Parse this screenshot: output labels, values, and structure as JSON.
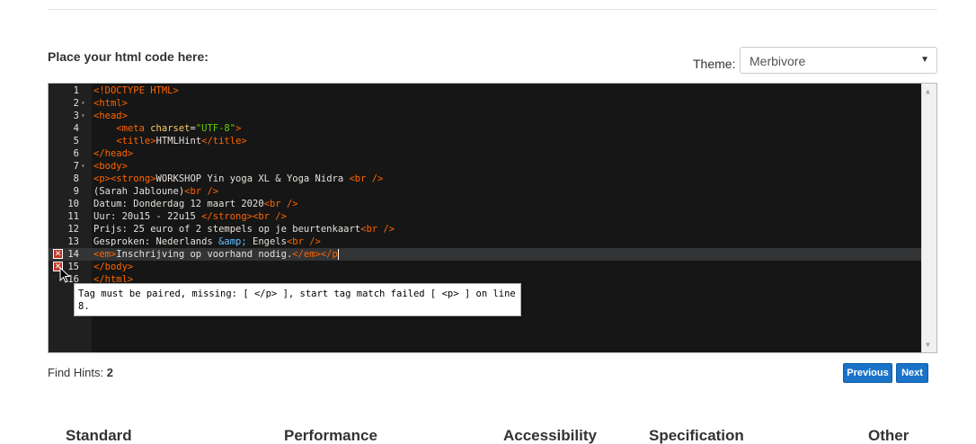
{
  "header": {
    "code_label": "Place your html code here:",
    "theme_label": "Theme:",
    "theme_value": "Merbivore"
  },
  "editor": {
    "lines": [
      {
        "n": "1",
        "fold": false,
        "error": false
      },
      {
        "n": "2",
        "fold": true,
        "error": false
      },
      {
        "n": "3",
        "fold": true,
        "error": false
      },
      {
        "n": "4",
        "fold": false,
        "error": false
      },
      {
        "n": "5",
        "fold": false,
        "error": false
      },
      {
        "n": "6",
        "fold": false,
        "error": false
      },
      {
        "n": "7",
        "fold": true,
        "error": false
      },
      {
        "n": "8",
        "fold": false,
        "error": false
      },
      {
        "n": "9",
        "fold": false,
        "error": false
      },
      {
        "n": "10",
        "fold": false,
        "error": false
      },
      {
        "n": "11",
        "fold": false,
        "error": false
      },
      {
        "n": "12",
        "fold": false,
        "error": false
      },
      {
        "n": "13",
        "fold": false,
        "error": false
      },
      {
        "n": "14",
        "fold": false,
        "error": true
      },
      {
        "n": "15",
        "fold": false,
        "error": true
      },
      {
        "n": "16",
        "fold": false,
        "error": false
      }
    ],
    "code": {
      "l1": "<!DOCTYPE HTML>",
      "l2": "<html>",
      "l3": "<head>",
      "l4_open": "<meta ",
      "l4_attr": "charset",
      "l4_eq": "=",
      "l4_str": "\"UTF-8\"",
      "l4_close": ">",
      "l5_open": "<title>",
      "l5_text": "HTMLHint",
      "l5_close": "</title>",
      "l6": "</head>",
      "l7": "<body>",
      "l8_tag": "<p><strong>",
      "l8_text": "WORKSHOP Yin yoga XL & Yoga Nidra ",
      "l8_br": "<br />",
      "l9_text": "(Sarah Jabloune)",
      "l9_br": "<br />",
      "l10_text": "Datum: Donderdag 12 maart 2020",
      "l10_br": "<br />",
      "l11_text": "Uur: 20u15 - 22u15 ",
      "l11_tag": "</strong><br />",
      "l12_text": "Prijs: 25 euro of 2 stempels op je beurtenkaart",
      "l12_br": "<br />",
      "l13_text": "Gesproken: Nederlands ",
      "l13_ent": "&amp;",
      "l13_text2": " Engels",
      "l13_br": "<br />",
      "l14_tag": "<em>",
      "l14_text": "Inschrijving op voorhand nodig.",
      "l14_tag2": "</em></p",
      "l15": "</body>",
      "l16": "</html>"
    },
    "tooltip": "Tag must be paired, missing: [ </p> ], start tag match failed [ <p> ] on line 8."
  },
  "footer": {
    "hints_label": "Find Hints: ",
    "hints_count": "2",
    "prev_label": "Previous",
    "next_label": "Next"
  },
  "categories": [
    "Standard",
    "Performance",
    "Accessibility",
    "Specification",
    "Other"
  ],
  "colors": {
    "editor_bg": "#161616",
    "tag": "#ff6400",
    "attr": "#ffcc66",
    "string": "#66cc00",
    "entity": "#64c0ff",
    "error_marker": "#c0392b",
    "button": "#1a73c8"
  }
}
